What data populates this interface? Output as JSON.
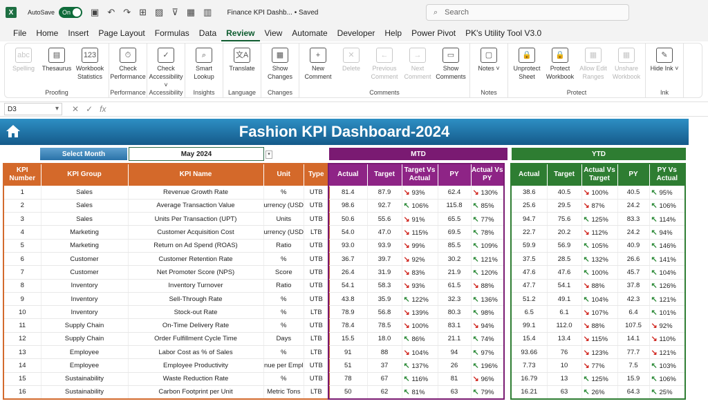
{
  "titlebar": {
    "autosave": "AutoSave",
    "toggle": "On",
    "doc": "Finance KPI Dashb... • Saved",
    "search": "Search"
  },
  "menu": [
    "File",
    "Home",
    "Insert",
    "Page Layout",
    "Formulas",
    "Data",
    "Review",
    "View",
    "Automate",
    "Developer",
    "Help",
    "Power Pivot",
    "PK's Utility Tool V3.0"
  ],
  "ribbon": [
    {
      "label": "Proofing",
      "buttons": [
        {
          "t": "Spelling",
          "d": true,
          "i": "abc"
        },
        {
          "t": "Thesaurus",
          "d": false,
          "i": "▤"
        },
        {
          "t": "Workbook Statistics",
          "d": false,
          "i": "123"
        }
      ]
    },
    {
      "label": "Performance",
      "buttons": [
        {
          "t": "Check Performance",
          "d": false,
          "i": "⏱"
        }
      ]
    },
    {
      "label": "Accessibility",
      "buttons": [
        {
          "t": "Check Accessibility ˅",
          "d": false,
          "i": "✓"
        }
      ]
    },
    {
      "label": "Insights",
      "buttons": [
        {
          "t": "Smart Lookup",
          "d": false,
          "i": "⌕"
        }
      ]
    },
    {
      "label": "Language",
      "buttons": [
        {
          "t": "Translate",
          "d": false,
          "i": "文A"
        }
      ]
    },
    {
      "label": "Changes",
      "buttons": [
        {
          "t": "Show Changes",
          "d": false,
          "i": "▦"
        }
      ]
    },
    {
      "label": "Comments",
      "buttons": [
        {
          "t": "New Comment",
          "d": false,
          "i": "+"
        },
        {
          "t": "Delete",
          "d": true,
          "i": "✕"
        },
        {
          "t": "Previous Comment",
          "d": true,
          "i": "←"
        },
        {
          "t": "Next Comment",
          "d": true,
          "i": "→"
        },
        {
          "t": "Show Comments",
          "d": false,
          "i": "▭"
        }
      ]
    },
    {
      "label": "Notes",
      "buttons": [
        {
          "t": "Notes ˅",
          "d": false,
          "i": "▢"
        }
      ]
    },
    {
      "label": "Protect",
      "buttons": [
        {
          "t": "Unprotect Sheet",
          "d": false,
          "i": "🔒"
        },
        {
          "t": "Protect Workbook",
          "d": false,
          "i": "🔒"
        },
        {
          "t": "Allow Edit Ranges",
          "d": true,
          "i": "▦"
        },
        {
          "t": "Unshare Workbook",
          "d": true,
          "i": "▦"
        }
      ]
    },
    {
      "label": "Ink",
      "buttons": [
        {
          "t": "Hide Ink ˅",
          "d": false,
          "i": "✎"
        }
      ]
    }
  ],
  "namebox": "D3",
  "banner": {
    "title": "Fashion KPI Dashboard-2024"
  },
  "select_month": {
    "label": "Select Month",
    "value": "May 2024"
  },
  "bands": {
    "mtd": "MTD",
    "ytd": "YTD"
  },
  "kpi_headers": [
    "KPI Number",
    "KPI Group",
    "KPI Name",
    "Unit",
    "Type"
  ],
  "mtd_headers": [
    "Actual",
    "Target",
    "Target Vs Actual",
    "PY",
    "Actual Vs PY"
  ],
  "ytd_headers": [
    "Actual",
    "Target",
    "Actual Vs Target",
    "PY",
    "PY Vs Actual"
  ],
  "rows": [
    {
      "n": "1",
      "g": "Sales",
      "k": "Revenue Growth Rate",
      "u": "%",
      "t": "UTB",
      "ma": "81.4",
      "mt": "87.9",
      "mtva": [
        "dn",
        "93%"
      ],
      "mpy": "62.4",
      "mavp": [
        "dn",
        "130%"
      ],
      "ya": "38.6",
      "yt": "40.5",
      "yavt": [
        "dn",
        "100%"
      ],
      "ypy": "40.5",
      "ypva": [
        "up",
        "95%"
      ]
    },
    {
      "n": "2",
      "g": "Sales",
      "k": "Average Transaction Value",
      "u": "urrency (USD",
      "t": "UTB",
      "ma": "98.6",
      "mt": "92.7",
      "mtva": [
        "up",
        "106%"
      ],
      "mpy": "115.8",
      "mavp": [
        "up",
        "85%"
      ],
      "ya": "25.6",
      "yt": "29.5",
      "yavt": [
        "dn",
        "87%"
      ],
      "ypy": "24.2",
      "ypva": [
        "up",
        "106%"
      ]
    },
    {
      "n": "3",
      "g": "Sales",
      "k": "Units Per Transaction (UPT)",
      "u": "Units",
      "t": "UTB",
      "ma": "50.6",
      "mt": "55.6",
      "mtva": [
        "dn",
        "91%"
      ],
      "mpy": "65.5",
      "mavp": [
        "up",
        "77%"
      ],
      "ya": "94.7",
      "yt": "75.6",
      "yavt": [
        "up",
        "125%"
      ],
      "ypy": "83.3",
      "ypva": [
        "up",
        "114%"
      ]
    },
    {
      "n": "4",
      "g": "Marketing",
      "k": "Customer Acquisition Cost",
      "u": "urrency (USD",
      "t": "LTB",
      "ma": "54.0",
      "mt": "47.0",
      "mtva": [
        "dn",
        "115%"
      ],
      "mpy": "69.5",
      "mavp": [
        "up",
        "78%"
      ],
      "ya": "22.7",
      "yt": "20.2",
      "yavt": [
        "dn",
        "112%"
      ],
      "ypy": "24.2",
      "ypva": [
        "up",
        "94%"
      ]
    },
    {
      "n": "5",
      "g": "Marketing",
      "k": "Return on Ad Spend (ROAS)",
      "u": "Ratio",
      "t": "UTB",
      "ma": "93.0",
      "mt": "93.9",
      "mtva": [
        "dn",
        "99%"
      ],
      "mpy": "85.5",
      "mavp": [
        "up",
        "109%"
      ],
      "ya": "59.9",
      "yt": "56.9",
      "yavt": [
        "up",
        "105%"
      ],
      "ypy": "40.9",
      "ypva": [
        "up",
        "146%"
      ]
    },
    {
      "n": "6",
      "g": "Customer",
      "k": "Customer Retention Rate",
      "u": "%",
      "t": "UTB",
      "ma": "36.7",
      "mt": "39.7",
      "mtva": [
        "dn",
        "92%"
      ],
      "mpy": "30.2",
      "mavp": [
        "up",
        "121%"
      ],
      "ya": "37.5",
      "yt": "28.5",
      "yavt": [
        "up",
        "132%"
      ],
      "ypy": "26.6",
      "ypva": [
        "up",
        "141%"
      ]
    },
    {
      "n": "7",
      "g": "Customer",
      "k": "Net Promoter Score (NPS)",
      "u": "Score",
      "t": "UTB",
      "ma": "26.4",
      "mt": "31.9",
      "mtva": [
        "dn",
        "83%"
      ],
      "mpy": "21.9",
      "mavp": [
        "up",
        "120%"
      ],
      "ya": "47.6",
      "yt": "47.6",
      "yavt": [
        "up",
        "100%"
      ],
      "ypy": "45.7",
      "ypva": [
        "up",
        "104%"
      ]
    },
    {
      "n": "8",
      "g": "Inventory",
      "k": "Inventory Turnover",
      "u": "Ratio",
      "t": "UTB",
      "ma": "54.1",
      "mt": "58.3",
      "mtva": [
        "dn",
        "93%"
      ],
      "mpy": "61.5",
      "mavp": [
        "dn",
        "88%"
      ],
      "ya": "47.7",
      "yt": "54.1",
      "yavt": [
        "dn",
        "88%"
      ],
      "ypy": "37.8",
      "ypva": [
        "up",
        "126%"
      ]
    },
    {
      "n": "9",
      "g": "Inventory",
      "k": "Sell-Through Rate",
      "u": "%",
      "t": "UTB",
      "ma": "43.8",
      "mt": "35.9",
      "mtva": [
        "up",
        "122%"
      ],
      "mpy": "32.3",
      "mavp": [
        "up",
        "136%"
      ],
      "ya": "51.2",
      "yt": "49.1",
      "yavt": [
        "up",
        "104%"
      ],
      "ypy": "42.3",
      "ypva": [
        "up",
        "121%"
      ]
    },
    {
      "n": "10",
      "g": "Inventory",
      "k": "Stock-out Rate",
      "u": "%",
      "t": "LTB",
      "ma": "78.9",
      "mt": "56.8",
      "mtva": [
        "dn",
        "139%"
      ],
      "mpy": "80.3",
      "mavp": [
        "up",
        "98%"
      ],
      "ya": "6.5",
      "yt": "6.1",
      "yavt": [
        "dn",
        "107%"
      ],
      "ypy": "6.4",
      "ypva": [
        "up",
        "101%"
      ]
    },
    {
      "n": "11",
      "g": "Supply Chain",
      "k": "On-Time Delivery Rate",
      "u": "%",
      "t": "UTB",
      "ma": "78.4",
      "mt": "78.5",
      "mtva": [
        "dn",
        "100%"
      ],
      "mpy": "83.1",
      "mavp": [
        "dn",
        "94%"
      ],
      "ya": "99.1",
      "yt": "112.0",
      "yavt": [
        "dn",
        "88%"
      ],
      "ypy": "107.5",
      "ypva": [
        "dn",
        "92%"
      ]
    },
    {
      "n": "12",
      "g": "Supply Chain",
      "k": "Order Fulfillment Cycle Time",
      "u": "Days",
      "t": "LTB",
      "ma": "15.5",
      "mt": "18.0",
      "mtva": [
        "up",
        "86%"
      ],
      "mpy": "21.1",
      "mavp": [
        "up",
        "74%"
      ],
      "ya": "15.4",
      "yt": "13.4",
      "yavt": [
        "dn",
        "115%"
      ],
      "ypy": "14.1",
      "ypva": [
        "dn",
        "110%"
      ]
    },
    {
      "n": "13",
      "g": "Employee",
      "k": "Labor Cost as % of Sales",
      "u": "%",
      "t": "LTB",
      "ma": "91",
      "mt": "88",
      "mtva": [
        "dn",
        "104%"
      ],
      "mpy": "94",
      "mavp": [
        "up",
        "97%"
      ],
      "ya": "93.66",
      "yt": "76",
      "yavt": [
        "dn",
        "123%"
      ],
      "ypy": "77.7",
      "ypva": [
        "dn",
        "121%"
      ]
    },
    {
      "n": "14",
      "g": "Employee",
      "k": "Employee Productivity",
      "u": "nue per Empl",
      "t": "UTB",
      "ma": "51",
      "mt": "37",
      "mtva": [
        "up",
        "137%"
      ],
      "mpy": "26",
      "mavp": [
        "up",
        "196%"
      ],
      "ya": "7.73",
      "yt": "10",
      "yavt": [
        "dn",
        "77%"
      ],
      "ypy": "7.5",
      "ypva": [
        "up",
        "103%"
      ]
    },
    {
      "n": "15",
      "g": "Sustainability",
      "k": "Waste Reduction Rate",
      "u": "%",
      "t": "UTB",
      "ma": "78",
      "mt": "67",
      "mtva": [
        "up",
        "116%"
      ],
      "mpy": "81",
      "mavp": [
        "dn",
        "96%"
      ],
      "ya": "16.79",
      "yt": "13",
      "yavt": [
        "up",
        "125%"
      ],
      "ypy": "15.9",
      "ypva": [
        "up",
        "106%"
      ]
    },
    {
      "n": "16",
      "g": "Sustainability",
      "k": "Carbon Footprint per Unit",
      "u": "Metric Tons",
      "t": "LTB",
      "ma": "50",
      "mt": "62",
      "mtva": [
        "up",
        "81%"
      ],
      "mpy": "63",
      "mavp": [
        "up",
        "79%"
      ],
      "ya": "16.21",
      "yt": "63",
      "yavt": [
        "up",
        "26%"
      ],
      "ypy": "64.3",
      "ypva": [
        "up",
        "25%"
      ]
    }
  ],
  "colors": {
    "banner": "#1f74a8",
    "kpi": "#d4692a",
    "mtd": "#8e2486",
    "ytd": "#2e7d32",
    "up": "#2e8b3a",
    "down": "#d0261f"
  }
}
